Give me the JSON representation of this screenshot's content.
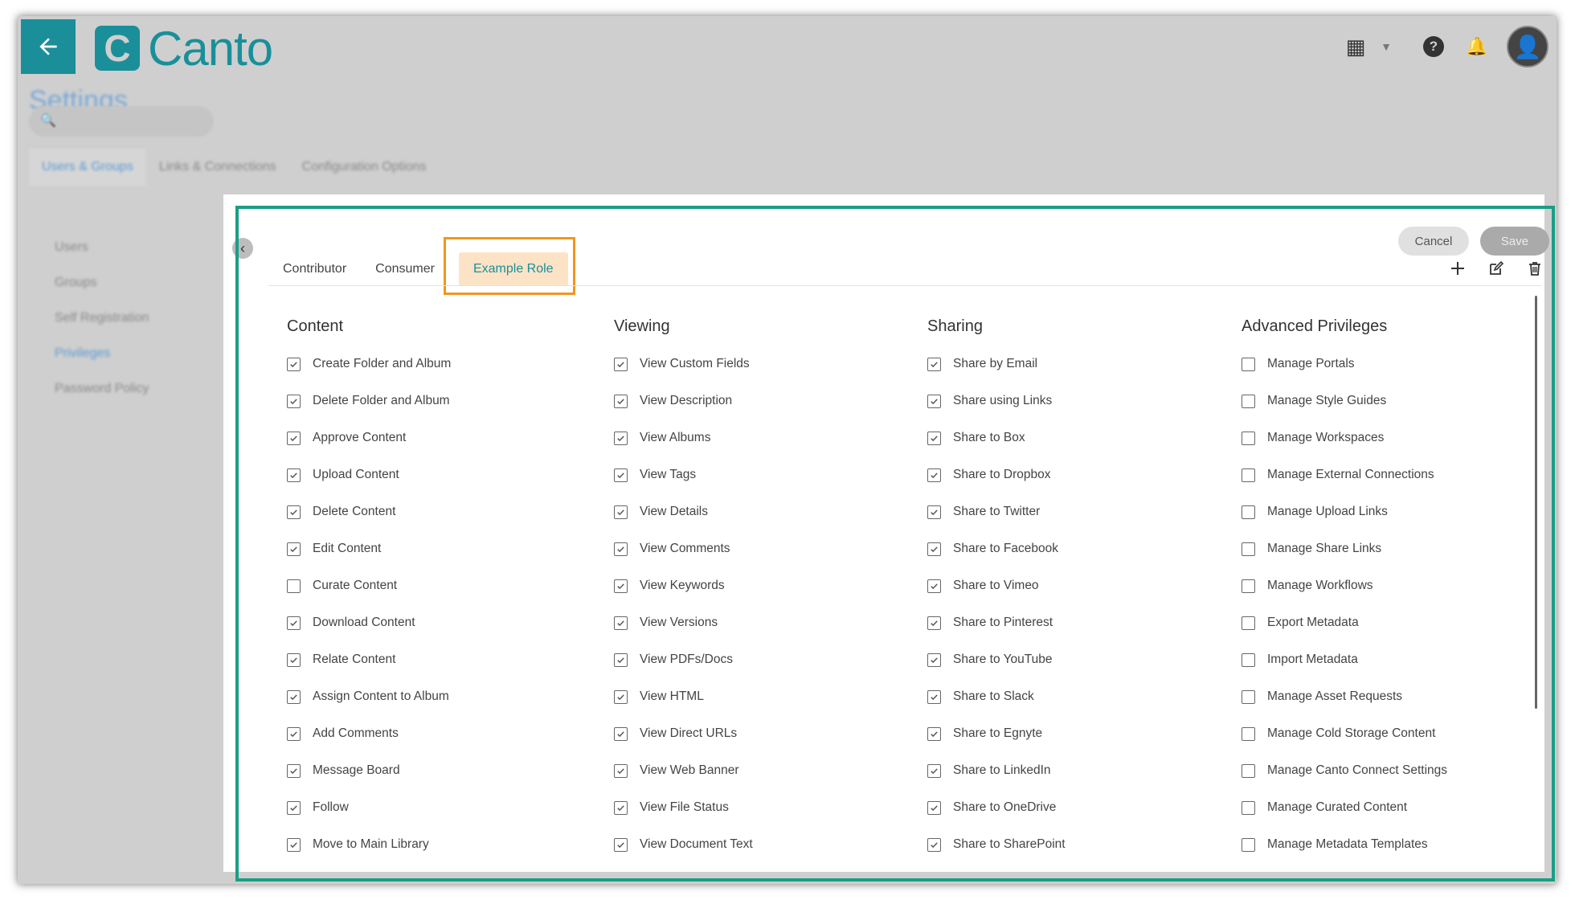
{
  "app": {
    "logo_text": "Canto",
    "logo_mark": "C",
    "settings_title": "Settings",
    "settings_tabs": [
      "Users & Groups",
      "Links & Connections",
      "Configuration Options"
    ],
    "sidebar_items": [
      "Users",
      "Groups",
      "Self Registration",
      "Privileges",
      "Password Policy"
    ],
    "accent_color": "#1a8f99"
  },
  "role_tabs": [
    {
      "label": "Contributor",
      "active": false
    },
    {
      "label": "Consumer",
      "active": false
    },
    {
      "label": "Example Role",
      "active": true
    }
  ],
  "buttons": {
    "cancel": "Cancel",
    "save": "Save"
  },
  "icons": {
    "back": "arrow-left-icon",
    "apps": "apps-grid-icon",
    "help": "help-icon",
    "notifications": "bell-icon",
    "avatar": "user-avatar-icon",
    "add": "plus-icon",
    "edit": "edit-icon",
    "delete": "trash-icon",
    "collapse": "chevron-left-icon"
  },
  "columns": [
    {
      "title": "Content",
      "items": [
        {
          "label": "Create Folder and Album",
          "checked": true
        },
        {
          "label": "Delete Folder and Album",
          "checked": true
        },
        {
          "label": "Approve Content",
          "checked": true
        },
        {
          "label": "Upload Content",
          "checked": true
        },
        {
          "label": "Delete Content",
          "checked": true
        },
        {
          "label": "Edit Content",
          "checked": true
        },
        {
          "label": "Curate Content",
          "checked": false
        },
        {
          "label": "Download Content",
          "checked": true
        },
        {
          "label": "Relate Content",
          "checked": true
        },
        {
          "label": "Assign Content to Album",
          "checked": true
        },
        {
          "label": "Add Comments",
          "checked": true
        },
        {
          "label": "Message Board",
          "checked": true
        },
        {
          "label": "Follow",
          "checked": true
        },
        {
          "label": "Move to Main Library",
          "checked": true
        }
      ]
    },
    {
      "title": "Viewing",
      "items": [
        {
          "label": "View Custom Fields",
          "checked": true
        },
        {
          "label": "View Description",
          "checked": true
        },
        {
          "label": "View Albums",
          "checked": true
        },
        {
          "label": "View Tags",
          "checked": true
        },
        {
          "label": "View Details",
          "checked": true
        },
        {
          "label": "View Comments",
          "checked": true
        },
        {
          "label": "View Keywords",
          "checked": true
        },
        {
          "label": "View Versions",
          "checked": true
        },
        {
          "label": "View PDFs/Docs",
          "checked": true
        },
        {
          "label": "View HTML",
          "checked": true
        },
        {
          "label": "View Direct URLs",
          "checked": true
        },
        {
          "label": "View Web Banner",
          "checked": true
        },
        {
          "label": "View File Status",
          "checked": true
        },
        {
          "label": "View Document Text",
          "checked": true
        }
      ]
    },
    {
      "title": "Sharing",
      "items": [
        {
          "label": "Share by Email",
          "checked": true
        },
        {
          "label": "Share using Links",
          "checked": true
        },
        {
          "label": "Share to Box",
          "checked": true
        },
        {
          "label": "Share to Dropbox",
          "checked": true
        },
        {
          "label": "Share to Twitter",
          "checked": true
        },
        {
          "label": "Share to Facebook",
          "checked": true
        },
        {
          "label": "Share to Vimeo",
          "checked": true
        },
        {
          "label": "Share to Pinterest",
          "checked": true
        },
        {
          "label": "Share to YouTube",
          "checked": true
        },
        {
          "label": "Share to Slack",
          "checked": true
        },
        {
          "label": "Share to Egnyte",
          "checked": true
        },
        {
          "label": "Share to LinkedIn",
          "checked": true
        },
        {
          "label": "Share to OneDrive",
          "checked": true
        },
        {
          "label": "Share to SharePoint",
          "checked": true
        }
      ]
    },
    {
      "title": "Advanced Privileges",
      "items": [
        {
          "label": "Manage Portals",
          "checked": false
        },
        {
          "label": "Manage Style Guides",
          "checked": false
        },
        {
          "label": "Manage Workspaces",
          "checked": false
        },
        {
          "label": "Manage External Connections",
          "checked": false
        },
        {
          "label": "Manage Upload Links",
          "checked": false
        },
        {
          "label": "Manage Share Links",
          "checked": false
        },
        {
          "label": "Manage Workflows",
          "checked": false
        },
        {
          "label": "Export Metadata",
          "checked": false
        },
        {
          "label": "Import Metadata",
          "checked": false
        },
        {
          "label": "Manage Asset Requests",
          "checked": false
        },
        {
          "label": "Manage Cold Storage Content",
          "checked": false
        },
        {
          "label": "Manage Canto Connect Settings",
          "checked": false
        },
        {
          "label": "Manage Curated Content",
          "checked": false
        },
        {
          "label": "Manage Metadata Templates",
          "checked": false
        }
      ]
    }
  ]
}
